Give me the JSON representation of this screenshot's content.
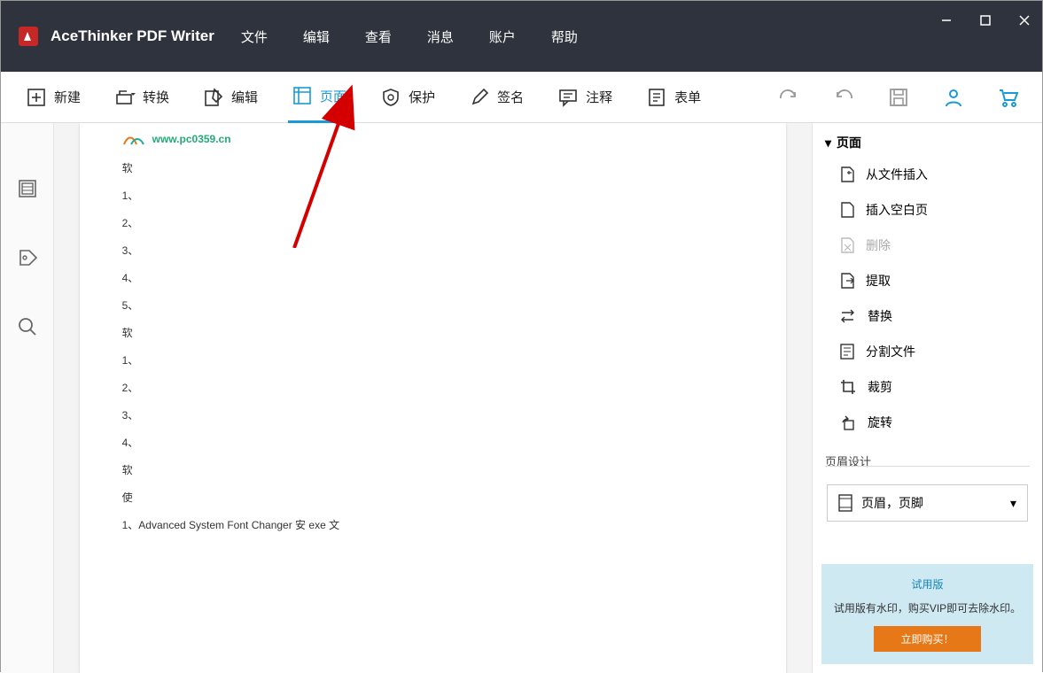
{
  "app": {
    "title": "AceThinker PDF Writer"
  },
  "menu": {
    "file": "文件",
    "edit": "编辑",
    "view": "查看",
    "message": "消息",
    "account": "账户",
    "help": "帮助"
  },
  "toolbar": {
    "new": "新建",
    "convert": "转换",
    "edit": "编辑",
    "page": "页面",
    "protect": "保护",
    "sign": "签名",
    "comment": "注释",
    "form": "表单"
  },
  "document": {
    "url": "www.pc0359.cn",
    "lines": [
      "软",
      "1、",
      "2、",
      "3、",
      "4、",
      "5、",
      "软",
      "1、",
      "2、",
      "3、",
      "4、",
      "软",
      "使"
    ],
    "last_line": "1、Advanced System Font Changer 安 exe 文"
  },
  "sidepanel": {
    "header": "页面",
    "items": {
      "insert_file": "从文件插入",
      "insert_blank": "插入空白页",
      "delete": "删除",
      "extract": "提取",
      "replace": "替换",
      "split": "分割文件",
      "crop": "裁剪",
      "rotate": "旋转"
    },
    "section2": "页眉设计",
    "dropdown": "页眉，页脚"
  },
  "trial": {
    "title": "试用版",
    "text": "试用版有水印，购买VIP即可去除水印。",
    "button": "立即购买！"
  }
}
